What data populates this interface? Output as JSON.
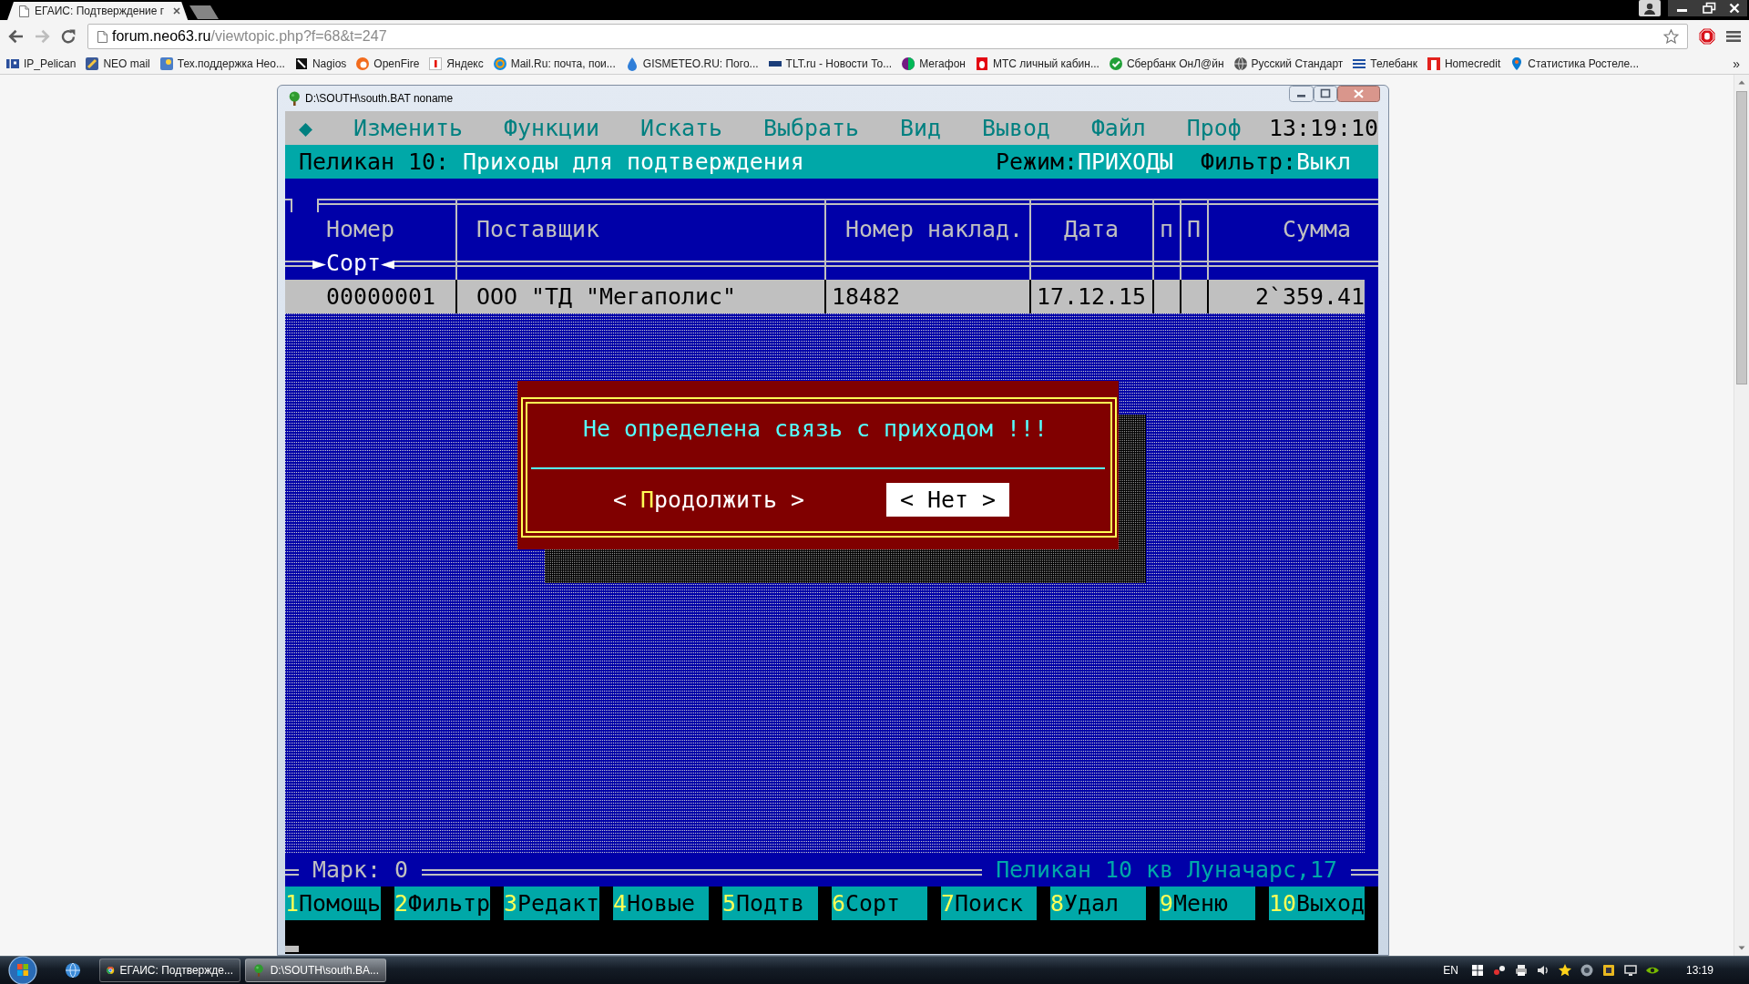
{
  "browser": {
    "tabs": [
      {
        "title": "ЕГАИС: Подтверждение г",
        "selected": true
      }
    ],
    "address": {
      "host": "forum.neo63.ru",
      "path": "/viewtopic.php?f=68&t=247"
    },
    "bookmarks": [
      "IP_Pelican",
      "NEO mail",
      "Тех.поддержка Нео...",
      "Nagios",
      "OpenFire",
      "Яндекс",
      "Mail.Ru: почта, пои...",
      "GISMETEO.RU: Пого...",
      "TLT.ru - Новости То...",
      "Мегафон",
      "МТС личный кабин...",
      "Сбербанк ОнЛ@йн",
      "Русский Стандарт",
      "Телебанк",
      "Homecredit",
      "Статистика Ростеле..."
    ],
    "bookmarks_overflow": "»"
  },
  "console_window": {
    "title": "D:\\SOUTH\\south.BAT noname",
    "menu": {
      "marker": "◆",
      "items": [
        "Изменить",
        "Функции",
        "Искать",
        "Выбрать",
        "Вид",
        "Вывод",
        "Файл",
        "Проф"
      ],
      "clock": "13:19:10"
    },
    "header": {
      "app": "Пеликан 10:",
      "title": "Приходы для подтверждения",
      "mode_label": "Режим:",
      "mode": "ПРИХОДЫ",
      "filter_label": "Фильтр:",
      "filter": "Выкл"
    },
    "table": {
      "columns": [
        "Номер",
        "Поставщик",
        "Номер наклад.",
        "Дата",
        "п",
        "П",
        "Сумма"
      ],
      "sort_indicator": "►Сорт◄",
      "rows": [
        {
          "selected": true,
          "number": "00000001",
          "supplier": "ООО \"ТД \"Мегаполис\"",
          "invoice_number": "18482",
          "date": "17.12.15",
          "sum": "2`359.41"
        }
      ]
    },
    "dialog": {
      "message": "Не определена связь с приходом !!!",
      "buttons": [
        {
          "label": "< **П**родолжить >",
          "selected": false
        },
        {
          "label": "< Нет >",
          "selected": true
        }
      ]
    },
    "status_line": {
      "mark": "Марк: 0",
      "location": "Пеликан 10 кв Луначарс,17"
    },
    "function_keys": [
      {
        "key": "1",
        "label": "Помощь"
      },
      {
        "key": "2",
        "label": "Фильтр"
      },
      {
        "key": "3",
        "label": "Редакт"
      },
      {
        "key": "4",
        "label": "Новые"
      },
      {
        "key": "5",
        "label": "Подтв"
      },
      {
        "key": "6",
        "label": "Сорт"
      },
      {
        "key": "7",
        "label": "Поиск"
      },
      {
        "key": "8",
        "label": "Удал"
      },
      {
        "key": "9",
        "label": "Меню"
      },
      {
        "key": "10",
        "label": "Выход"
      }
    ]
  },
  "taskbar": {
    "items": [
      {
        "label": "ЕГАИС: Подтвержде...",
        "selected": false
      },
      {
        "label": "D:\\SOUTH\\south.BA...",
        "selected": true
      }
    ],
    "language": "EN",
    "clock": "13:19"
  }
}
